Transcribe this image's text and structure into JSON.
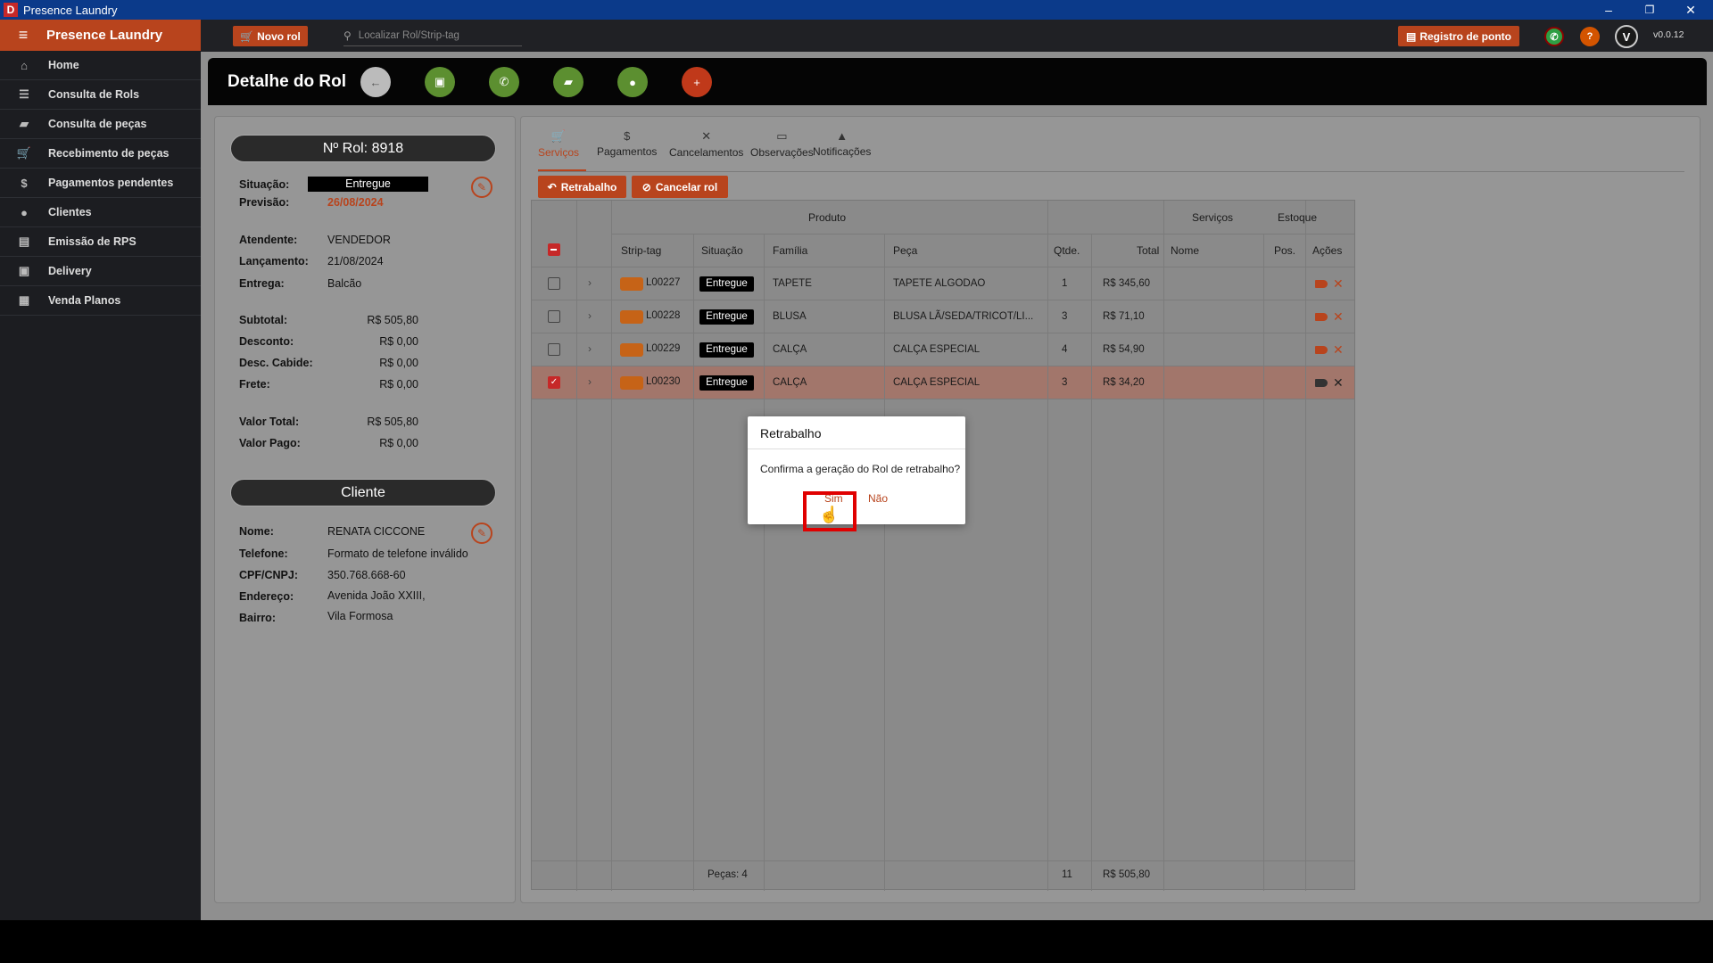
{
  "window": {
    "title": "Presence Laundry",
    "minimize": "–",
    "maximize": "❐",
    "close": "✕"
  },
  "sidebar": {
    "brand": "Presence Laundry",
    "items": [
      {
        "label": "Home",
        "icon": "home-icon",
        "glyph": "⌂"
      },
      {
        "label": "Consulta de Rols",
        "icon": "list-filter-icon",
        "glyph": "☰"
      },
      {
        "label": "Consulta de peças",
        "icon": "tag-icon",
        "glyph": "▰"
      },
      {
        "label": "Recebimento de peças",
        "icon": "cart-icon",
        "glyph": "🛒"
      },
      {
        "label": "Pagamentos pendentes",
        "icon": "dollar-icon",
        "glyph": "$"
      },
      {
        "label": "Clientes",
        "icon": "person-icon",
        "glyph": "●"
      },
      {
        "label": "Emissão de RPS",
        "icon": "receipt-icon",
        "glyph": "▤"
      },
      {
        "label": "Delivery",
        "icon": "truck-icon",
        "glyph": "▣"
      },
      {
        "label": "Venda Planos",
        "icon": "store-icon",
        "glyph": "▦"
      }
    ]
  },
  "topbar": {
    "novo_rol": "Novo rol",
    "search_placeholder": "Localizar Rol/Strip-tag",
    "registro_ponto": "Registro de ponto",
    "avatar_letter": "V",
    "version": "v0.0.12",
    "colors": {
      "accent": "#b8441d",
      "whatsapp": "#2e9e44",
      "help": "#d35400"
    }
  },
  "header": {
    "title": "Detalhe do Rol"
  },
  "rol": {
    "numero": "Nº Rol: 8918",
    "situacao_label": "Situação:",
    "situacao": "Entregue",
    "previsao_label": "Previsão:",
    "previsao": "26/08/2024",
    "atendente_label": "Atendente:",
    "atendente": "VENDEDOR",
    "lancamento_label": "Lançamento:",
    "lancamento": "21/08/2024",
    "entrega_label": "Entrega:",
    "entrega": "Balcão",
    "subtotal_label": "Subtotal:",
    "subtotal": "R$ 505,80",
    "desconto_label": "Desconto:",
    "desconto": "R$ 0,00",
    "desc_cabide_label": "Desc. Cabide:",
    "desc_cabide": "R$ 0,00",
    "frete_label": "Frete:",
    "frete": "R$ 0,00",
    "valor_total_label": "Valor Total:",
    "valor_total": "R$ 505,80",
    "valor_pago_label": "Valor Pago:",
    "valor_pago": "R$ 0,00"
  },
  "cliente": {
    "title": "Cliente",
    "nome_label": "Nome:",
    "nome": "RENATA CICCONE",
    "telefone_label": "Telefone:",
    "telefone": "Formato de telefone inválido",
    "cpf_label": "CPF/CNPJ:",
    "cpf": "350.768.668-60",
    "endereco_label": "Endereço:",
    "endereco": "Avenida João XXIII,",
    "bairro_label": "Bairro:",
    "bairro": "Vila Formosa"
  },
  "tabs": [
    {
      "label": "Serviços",
      "icon": "cart-icon",
      "glyph": "🛒",
      "active": true
    },
    {
      "label": "Pagamentos",
      "icon": "dollar-icon",
      "glyph": "$"
    },
    {
      "label": "Cancelamentos",
      "icon": "close-icon",
      "glyph": "✕"
    },
    {
      "label": "Observações",
      "icon": "comment-icon",
      "glyph": "▭"
    },
    {
      "label": "Notificações",
      "icon": "bell-icon",
      "glyph": "▲"
    }
  ],
  "actions": {
    "retrabalho": "Retrabalho",
    "cancelar": "Cancelar rol"
  },
  "table": {
    "groups": {
      "produto": "Produto",
      "servicos": "Serviços",
      "estoque": "Estoque"
    },
    "columns": [
      "Strip-tag",
      "Situação",
      "Família",
      "Peça",
      "Qtde.",
      "Total",
      "Nome",
      "Pos.",
      "Ações"
    ],
    "rows": [
      {
        "tag": "L00227",
        "situacao": "Entregue",
        "familia": "TAPETE",
        "peca": "TAPETE ALGODAO",
        "qtde": "1",
        "total": "R$ 345,60",
        "checked": false
      },
      {
        "tag": "L00228",
        "situacao": "Entregue",
        "familia": "BLUSA",
        "peca": "BLUSA LÃ/SEDA/TRICOT/LI...",
        "qtde": "3",
        "total": "R$ 71,10",
        "checked": false
      },
      {
        "tag": "L00229",
        "situacao": "Entregue",
        "familia": "CALÇA",
        "peca": "CALÇA ESPECIAL",
        "qtde": "4",
        "total": "R$ 54,90",
        "checked": false
      },
      {
        "tag": "L00230",
        "situacao": "Entregue",
        "familia": "CALÇA",
        "peca": "CALÇA ESPECIAL",
        "qtde": "3",
        "total": "R$ 34,20",
        "checked": true
      }
    ],
    "footer": {
      "pecas": "Peças: 4",
      "qtde": "11",
      "total": "R$ 505,80"
    }
  },
  "dialog": {
    "title": "Retrabalho",
    "message": "Confirma a geração do Rol de retrabalho?",
    "yes": "Sim",
    "no": "Não"
  }
}
